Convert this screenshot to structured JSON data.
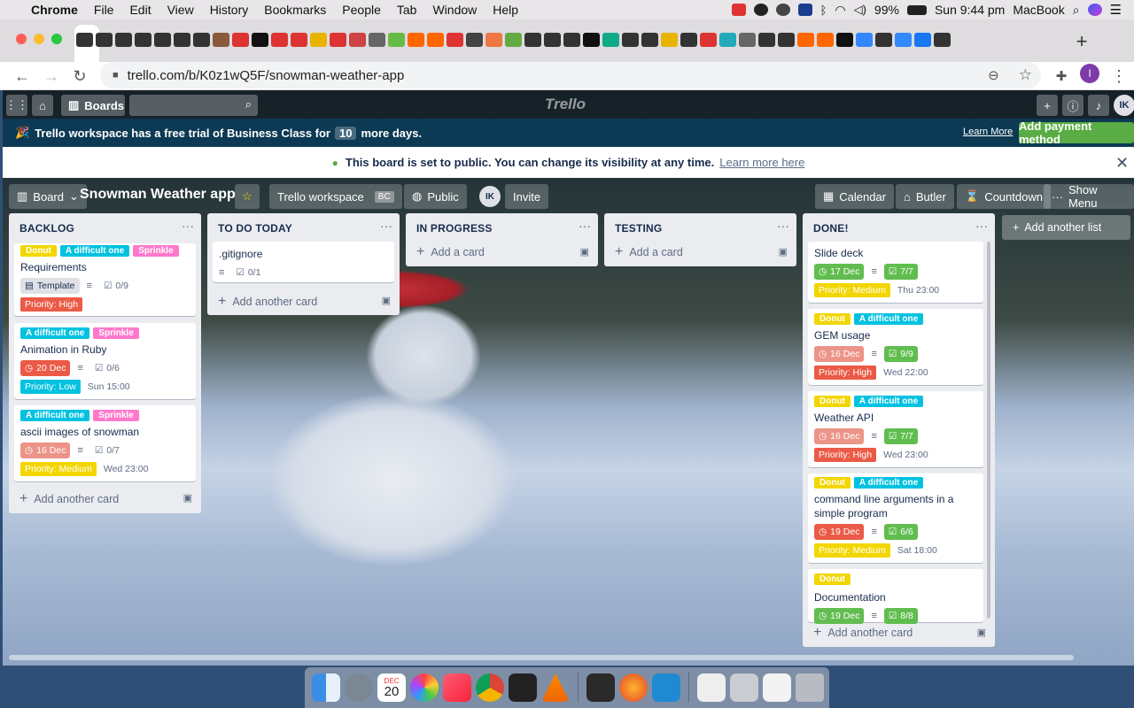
{
  "menubar": {
    "app": "Chrome",
    "items": [
      "File",
      "Edit",
      "View",
      "History",
      "Bookmarks",
      "People",
      "Tab",
      "Window",
      "Help"
    ],
    "battery": "99%",
    "clock": "Sun 9:44 pm",
    "computer_name": "MacBook"
  },
  "browser": {
    "url_host": "trello.com",
    "url_path": "/b/K0z1wQ5F/snowman-weather-app",
    "profile_initial": "I"
  },
  "trello_nav": {
    "boards_label": "Boards",
    "logo": "Trello",
    "user_initials": "IK"
  },
  "trial_banner": {
    "prefix": "Trello workspace has a free trial of Business Class for",
    "days": "10",
    "suffix": "more days.",
    "learn_more": "Learn More",
    "add_payment": "Add payment method"
  },
  "public_notice": {
    "message": "This board is set to public. You can change its visibility at any time.",
    "link": "Learn more here"
  },
  "board_header": {
    "view_switcher": "Board",
    "title": "Snowman Weather app",
    "workspace": "Trello workspace",
    "workspace_badge": "BC",
    "visibility": "Public",
    "member_initials": "IK",
    "invite": "Invite",
    "calendar": "Calendar",
    "butler": "Butler",
    "countdown": "Countdown",
    "show_menu": "Show Menu"
  },
  "lists": {
    "backlog": {
      "title": "BACKLOG",
      "add_card": "Add another card",
      "cards": [
        {
          "labels": [
            "Donut",
            "A difficult one",
            "Sprinkle"
          ],
          "title": "Requirements",
          "template": "Template",
          "checklist": "0/9",
          "priority": "Priority: High"
        },
        {
          "labels": [
            "A difficult one",
            "Sprinkle"
          ],
          "title": "Animation in Ruby",
          "due": "20 Dec",
          "checklist": "0/6",
          "priority": "Priority: Low",
          "time": "Sun 15:00"
        },
        {
          "labels": [
            "A difficult one",
            "Sprinkle"
          ],
          "title": "ascii images of snowman",
          "due": "16 Dec",
          "checklist": "0/7",
          "priority": "Priority: Medium",
          "time": "Wed 23:00"
        }
      ]
    },
    "todo": {
      "title": "TO DO TODAY",
      "add_card": "Add another card",
      "cards": [
        {
          "title": ".gitignore",
          "checklist": "0/1"
        }
      ]
    },
    "in_progress": {
      "title": "IN PROGRESS",
      "add_card": "Add a card"
    },
    "testing": {
      "title": "TESTING",
      "add_card": "Add a card"
    },
    "done": {
      "title": "DONE!",
      "add_card": "Add another card",
      "cards": [
        {
          "title": "Slide deck",
          "due": "17 Dec",
          "checklist": "7/7",
          "priority": "Priority: Medium",
          "time": "Thu 23:00"
        },
        {
          "labels": [
            "Donut",
            "A difficult one"
          ],
          "title": "GEM usage",
          "due": "16 Dec",
          "checklist": "9/9",
          "priority": "Priority: High",
          "time": "Wed 22:00"
        },
        {
          "labels": [
            "Donut",
            "A difficult one"
          ],
          "title": "Weather API",
          "due": "16 Dec",
          "checklist": "7/7",
          "priority": "Priority: High",
          "time": "Wed 23:00"
        },
        {
          "labels": [
            "Donut",
            "A difficult one"
          ],
          "title": "command line arguments in a simple program",
          "due": "19 Dec",
          "checklist": "6/6",
          "priority": "Priority: Medium",
          "time": "Sat 18:00"
        },
        {
          "labels": [
            "Donut"
          ],
          "title": "Documentation",
          "due": "19 Dec",
          "checklist": "8/8"
        }
      ]
    }
  },
  "add_list": "Add another list",
  "colors": {
    "label_yellow": "#f2d600",
    "label_sky": "#00c2e0",
    "label_pink": "#ff78cb",
    "due_red": "#eb5a46",
    "checklist_green": "#61bd4f",
    "trial_banner_bg": "#0c3953",
    "payment_green": "#5aac44"
  },
  "dock": {
    "calendar_month": "DEC",
    "calendar_day": "20"
  }
}
